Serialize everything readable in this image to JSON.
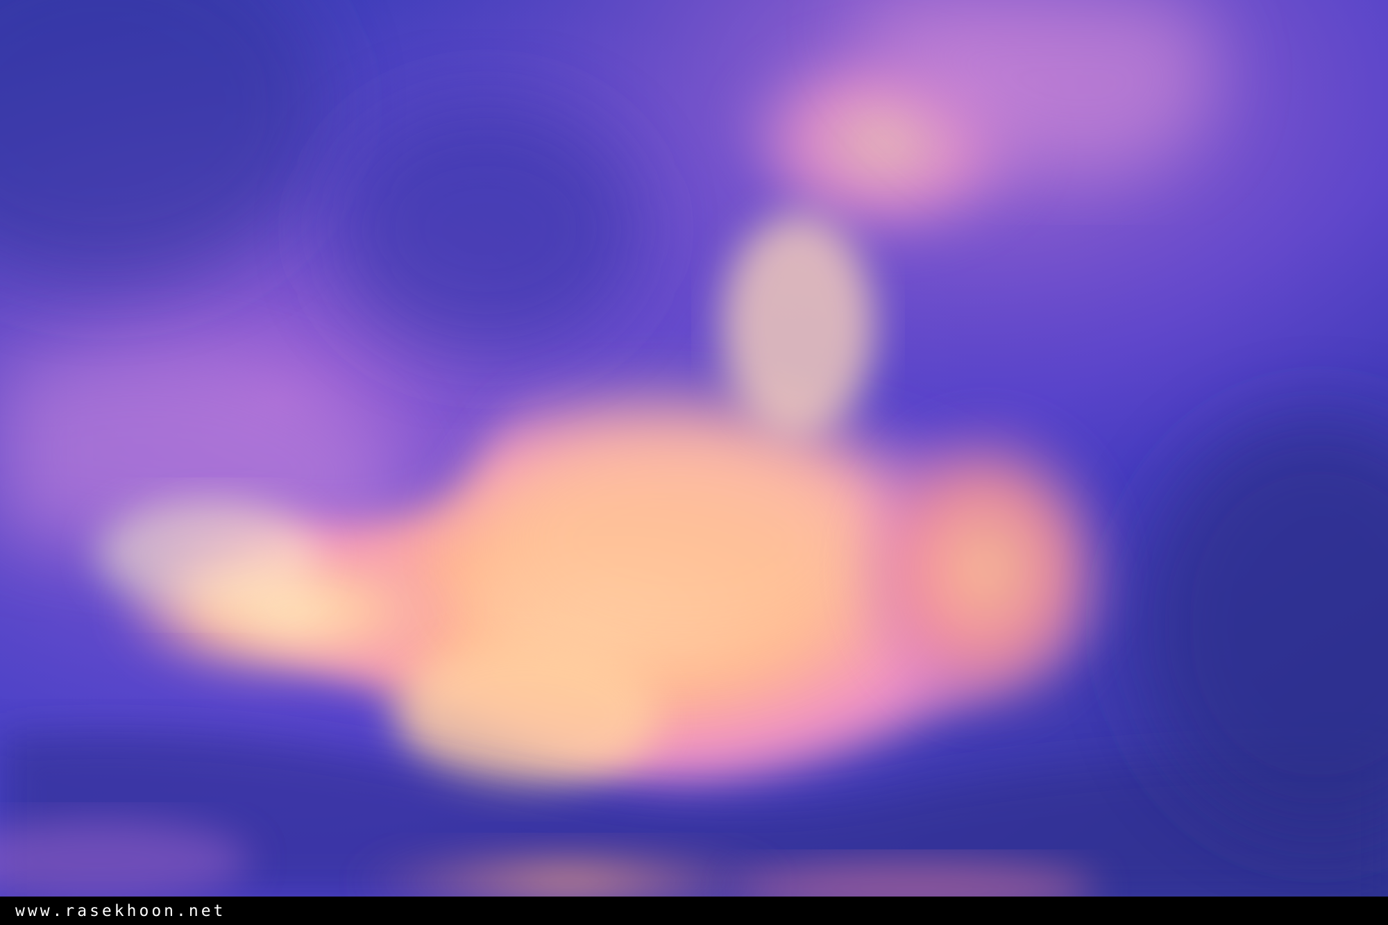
{
  "photo": {
    "subject": "sunset-clouds",
    "colors": {
      "sky_deep": "#3a3fb0",
      "sky_violet": "#6a4ad0",
      "cloud_pink": "#e98ad0",
      "cloud_glow": "#ffb38a",
      "cloud_highlight": "#ffe0a8"
    }
  },
  "watermark": {
    "text": "www.rasekhoon.net"
  }
}
